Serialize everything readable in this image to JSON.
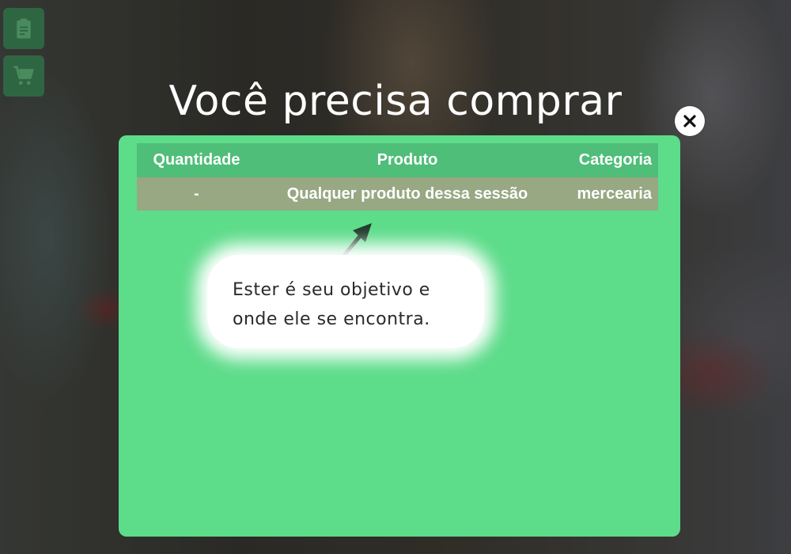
{
  "page": {
    "title": "Você precisa comprar"
  },
  "sidebar": {
    "buttons": [
      {
        "icon": "clipboard-icon"
      },
      {
        "icon": "cart-icon"
      }
    ]
  },
  "modal": {
    "close_icon": "close-icon",
    "table": {
      "headers": [
        "Quantidade",
        "Produto",
        "Categoria"
      ],
      "rows": [
        {
          "quantidade": "-",
          "produto": "Qualquer produto dessa sessão",
          "categoria": "mercearia"
        }
      ]
    },
    "tooltip": {
      "line1": "Ester é seu objetivo e",
      "line2": "onde ele se encontra."
    }
  },
  "colors": {
    "panel": "#5ddc8a",
    "header_row": "#4fbe78",
    "data_row": "#97a883",
    "side_button": "#2f6f45"
  }
}
